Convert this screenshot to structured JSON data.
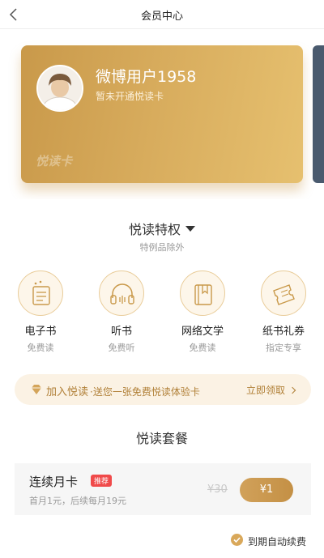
{
  "nav": {
    "title": "会员中心",
    "back_icon": "chevron-left-icon"
  },
  "card": {
    "username": "微博用户1958",
    "status": "暂未开通悦读卡",
    "logo_text": "悦读卡",
    "gradient_colors": [
      "#c9994a",
      "#e6c06f"
    ]
  },
  "privileges": {
    "title": "悦读特权",
    "subtitle": "特例品除外",
    "items": [
      {
        "name": "电子书",
        "desc": "免费读",
        "icon": "ebook-icon"
      },
      {
        "name": "听书",
        "desc": "免费听",
        "icon": "headphones-icon"
      },
      {
        "name": "网络文学",
        "desc": "免费读",
        "icon": "book-icon"
      },
      {
        "name": "纸书礼券",
        "desc": "指定专享",
        "icon": "coupon-icon"
      }
    ]
  },
  "promo": {
    "join_text": "加入悦读",
    "detail_text": "·送您一张免费悦读体验卡",
    "claim_text": "立即领取"
  },
  "packages": {
    "title": "悦读套餐",
    "plan": {
      "name": "连续月卡",
      "badge": "推荐",
      "desc": "首月1元，后续每月19元",
      "old_price": "¥30",
      "price": "¥1"
    }
  },
  "renew": {
    "label": "到期自动续费",
    "checked": true
  },
  "colors": {
    "accent": "#d4a55a",
    "badge": "#f04a4a",
    "promo_bg": "#fbf2e4"
  }
}
